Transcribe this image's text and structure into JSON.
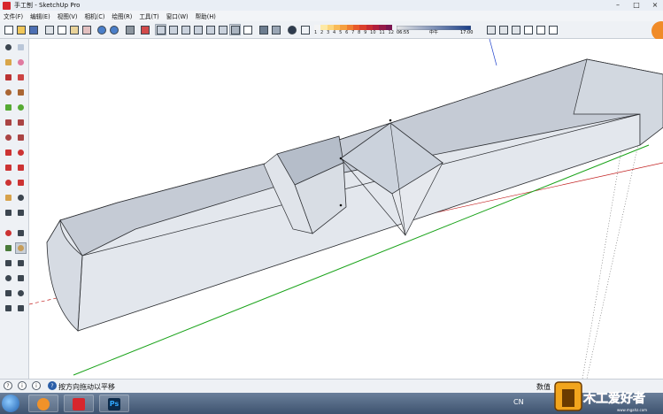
{
  "window": {
    "title": "手工刨 - SketchUp Pro",
    "controls": [
      "–",
      "□",
      "×"
    ]
  },
  "menu": [
    "文件(F)",
    "编辑(E)",
    "视图(V)",
    "相机(C)",
    "绘图(R)",
    "工具(T)",
    "窗口(W)",
    "帮助(H)"
  ],
  "shadow_scale": {
    "labels": [
      "1",
      "2",
      "3",
      "4",
      "5",
      "6",
      "7",
      "8",
      "9",
      "10",
      "11",
      "12"
    ],
    "colors": [
      "#f4f4f4",
      "#fde9a6",
      "#fcd57b",
      "#f9bb57",
      "#f59f3f",
      "#ef7d31",
      "#e75a2b",
      "#da3f2c",
      "#c72b32",
      "#b01f3d",
      "#941a48",
      "#7a1550"
    ]
  },
  "time_slider": {
    "start": "06:55",
    "mid": "中午",
    "end": "17:00",
    "colors": [
      "#e6e6e6",
      "#1a3e88"
    ]
  },
  "status": {
    "message": "按方向拖动以平移",
    "measure_label": "数值",
    "icons": [
      "?",
      "i",
      "i"
    ]
  },
  "taskbar": {
    "input_lang": "CN",
    "ps_label": "Ps"
  },
  "watermark": {
    "text": "木工爱好者",
    "sub": "www.mgahz.com"
  },
  "colors": {
    "model_face": "#d6dbe3",
    "model_top": "#c5cbd5",
    "model_edge": "#2d2f33",
    "green_axis": "#1aa31a",
    "red_axis": "#c22020",
    "blue_axis": "#2244cc"
  }
}
